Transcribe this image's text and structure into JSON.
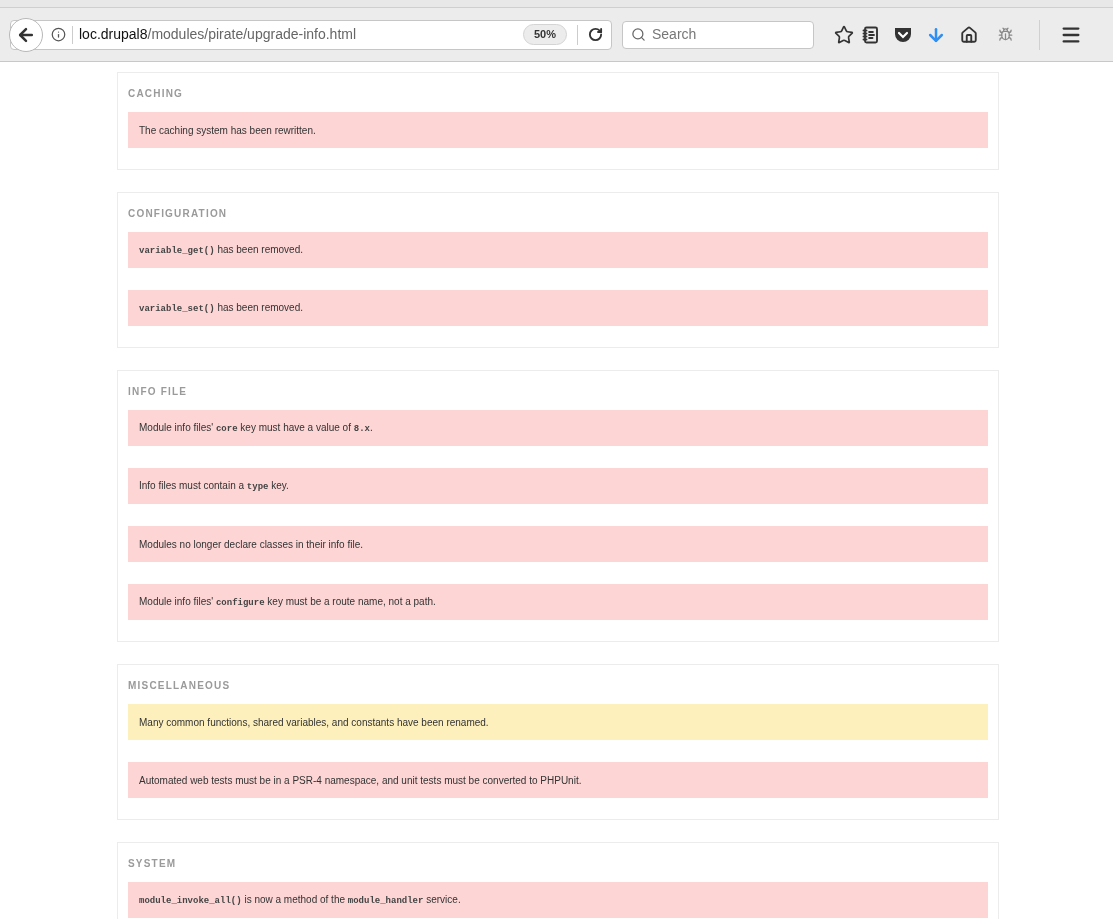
{
  "toolbar": {
    "url": {
      "host": "loc.drupal8",
      "path": "/modules/pirate/upgrade-info.html"
    },
    "zoom": "50%",
    "search": {
      "placeholder": "Search"
    }
  },
  "sections": [
    {
      "title": "CACHING",
      "messages": [
        {
          "kind": "error",
          "parts": [
            {
              "text": "The caching system has been rewritten.",
              "code": false
            }
          ]
        }
      ]
    },
    {
      "title": "CONFIGURATION",
      "messages": [
        {
          "kind": "error",
          "parts": [
            {
              "text": "variable_get()",
              "code": true
            },
            {
              "text": " has been removed.",
              "code": false
            }
          ]
        },
        {
          "kind": "error",
          "parts": [
            {
              "text": "variable_set()",
              "code": true
            },
            {
              "text": " has been removed.",
              "code": false
            }
          ]
        }
      ]
    },
    {
      "title": "INFO FILE",
      "messages": [
        {
          "kind": "error",
          "parts": [
            {
              "text": "Module info files' ",
              "code": false
            },
            {
              "text": "core",
              "code": true
            },
            {
              "text": " key must have a value of ",
              "code": false
            },
            {
              "text": "8.x",
              "code": true
            },
            {
              "text": ".",
              "code": false
            }
          ]
        },
        {
          "kind": "error",
          "parts": [
            {
              "text": "Info files must contain a ",
              "code": false
            },
            {
              "text": "type",
              "code": true
            },
            {
              "text": " key.",
              "code": false
            }
          ]
        },
        {
          "kind": "error",
          "parts": [
            {
              "text": "Modules no longer declare classes in their info file.",
              "code": false
            }
          ]
        },
        {
          "kind": "error",
          "parts": [
            {
              "text": "Module info files' ",
              "code": false
            },
            {
              "text": "configure",
              "code": true
            },
            {
              "text": " key must be a route name, not a path.",
              "code": false
            }
          ]
        }
      ]
    },
    {
      "title": "MISCELLANEOUS",
      "messages": [
        {
          "kind": "warning",
          "parts": [
            {
              "text": "Many common functions, shared variables, and constants have been renamed.",
              "code": false
            }
          ]
        },
        {
          "kind": "error",
          "parts": [
            {
              "text": "Automated web tests must be in a PSR-4 namespace, and unit tests must be converted to PHPUnit.",
              "code": false
            }
          ]
        }
      ]
    },
    {
      "title": "SYSTEM",
      "messages": [
        {
          "kind": "error",
          "parts": [
            {
              "text": "module_invoke_all()",
              "code": true
            },
            {
              "text": " is now a method of the ",
              "code": false
            },
            {
              "text": "module_handler",
              "code": true
            },
            {
              "text": " service.",
              "code": false
            }
          ]
        }
      ]
    }
  ]
}
